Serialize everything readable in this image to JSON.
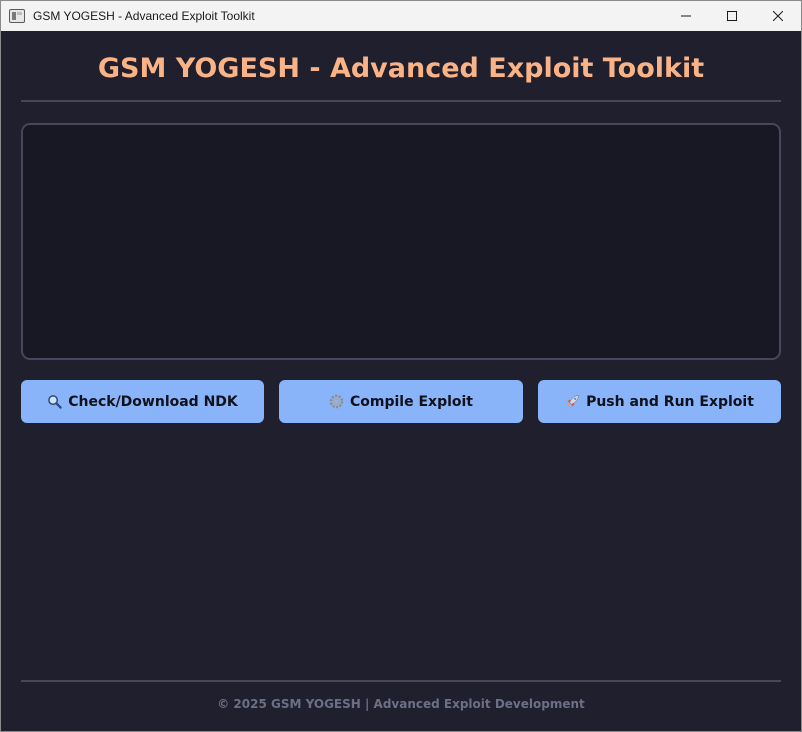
{
  "window": {
    "title": "GSM YOGESH - Advanced Exploit Toolkit",
    "icon": "app-window-icon",
    "controls": [
      "minimize-icon",
      "maximize-icon",
      "close-icon"
    ]
  },
  "header": {
    "title": "GSM YOGESH - Advanced Exploit Toolkit"
  },
  "output": {
    "value": ""
  },
  "buttons": [
    {
      "label": "Check/Download NDK",
      "icon": "magnifier-icon"
    },
    {
      "label": "Compile Exploit",
      "icon": "gear-icon"
    },
    {
      "label": "Push and Run Exploit",
      "icon": "rocket-icon"
    }
  ],
  "footer": {
    "text": "© 2025 GSM YOGESH | Advanced Exploit Development"
  },
  "colors": {
    "background": "#1f1f2e",
    "title": "#fab387",
    "button": "#89b4fa",
    "output_bg": "#181825",
    "border": "#45475a",
    "footer_text": "#6c7086"
  }
}
